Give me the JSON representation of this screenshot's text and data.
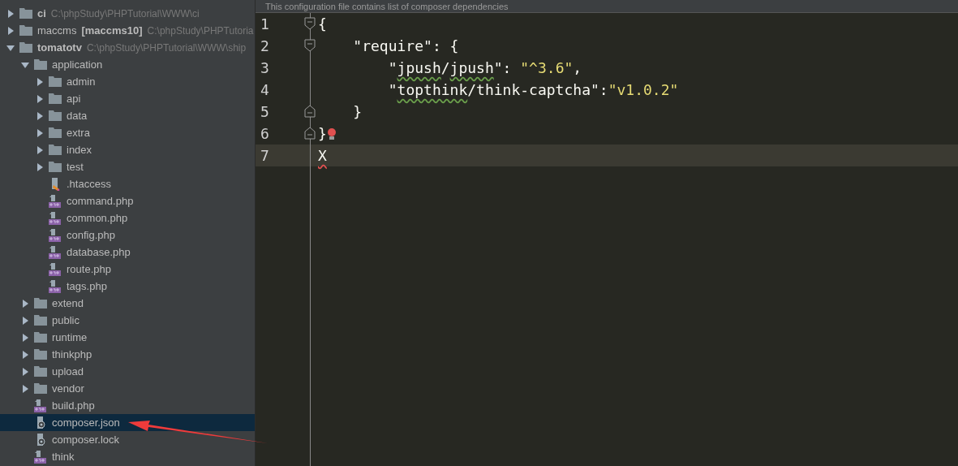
{
  "editor_banner": "This configuration file contains list of composer dependencies",
  "project_tree": [
    {
      "name": "ci",
      "bold": true,
      "path": "C:\\phpStudy\\PHPTutorial\\WWW\\ci",
      "kind": "folder",
      "expanded": false,
      "selected": false
    },
    {
      "name": "maccms",
      "bold": false,
      "module": "[maccms10]",
      "path": "C:\\phpStudy\\PHPTutoria",
      "kind": "folder",
      "expanded": false,
      "selected": false
    },
    {
      "name": "tomatotv",
      "bold": true,
      "path": "C:\\phpStudy\\PHPTutorial\\WWW\\ship",
      "kind": "folder",
      "expanded": true,
      "selected": false,
      "children": [
        {
          "name": "application",
          "kind": "folder",
          "expanded": true,
          "selected": false,
          "children": [
            {
              "name": "admin",
              "kind": "folder",
              "expanded": false,
              "selected": false
            },
            {
              "name": "api",
              "kind": "folder",
              "expanded": false,
              "selected": false
            },
            {
              "name": "data",
              "kind": "folder",
              "expanded": false,
              "selected": false
            },
            {
              "name": "extra",
              "kind": "folder",
              "expanded": false,
              "selected": false
            },
            {
              "name": "index",
              "kind": "folder",
              "expanded": false,
              "selected": false
            },
            {
              "name": "test",
              "kind": "folder",
              "expanded": false,
              "selected": false
            },
            {
              "name": ".htaccess",
              "kind": "htaccess",
              "selected": false
            },
            {
              "name": "command.php",
              "kind": "php",
              "selected": false
            },
            {
              "name": "common.php",
              "kind": "php",
              "selected": false
            },
            {
              "name": "config.php",
              "kind": "php",
              "selected": false
            },
            {
              "name": "database.php",
              "kind": "php",
              "selected": false
            },
            {
              "name": "route.php",
              "kind": "php",
              "selected": false
            },
            {
              "name": "tags.php",
              "kind": "php",
              "selected": false
            }
          ]
        },
        {
          "name": "extend",
          "kind": "folder",
          "expanded": false,
          "selected": false
        },
        {
          "name": "public",
          "kind": "folder",
          "expanded": false,
          "selected": false
        },
        {
          "name": "runtime",
          "kind": "folder",
          "expanded": false,
          "selected": false
        },
        {
          "name": "thinkphp",
          "kind": "folder",
          "expanded": false,
          "selected": false
        },
        {
          "name": "upload",
          "kind": "folder",
          "expanded": false,
          "selected": false
        },
        {
          "name": "vendor",
          "kind": "folder",
          "expanded": false,
          "selected": false
        },
        {
          "name": "build.php",
          "kind": "php",
          "selected": false
        },
        {
          "name": "composer.json",
          "kind": "composer",
          "selected": true
        },
        {
          "name": "composer.lock",
          "kind": "composer",
          "selected": false
        },
        {
          "name": "think",
          "kind": "php",
          "selected": false
        }
      ]
    }
  ],
  "code_lines": [
    {
      "number": "1",
      "kind": "fold-start",
      "current": false,
      "tokens": [
        {
          "text": "{",
          "kind": "punct"
        }
      ]
    },
    {
      "number": "2",
      "kind": "fold-start",
      "current": false,
      "tokens": [
        {
          "text": "    \"require\": {",
          "kind": "punct"
        }
      ]
    },
    {
      "number": "3",
      "kind": "plain",
      "current": false,
      "tokens": [
        {
          "text": "        \"",
          "kind": "punct"
        },
        {
          "text": "jpush",
          "kind": "typo"
        },
        {
          "text": "/",
          "kind": "punct"
        },
        {
          "text": "jpush",
          "kind": "typo"
        },
        {
          "text": "\": ",
          "kind": "punct"
        },
        {
          "text": "\"^3.6\"",
          "kind": "string"
        },
        {
          "text": ",",
          "kind": "punct"
        }
      ]
    },
    {
      "number": "4",
      "kind": "plain",
      "current": false,
      "tokens": [
        {
          "text": "        \"",
          "kind": "punct"
        },
        {
          "text": "topthink",
          "kind": "typo"
        },
        {
          "text": "/think-captcha\":",
          "kind": "punct"
        },
        {
          "text": "\"v1.0.2\"",
          "kind": "string"
        }
      ]
    },
    {
      "number": "5",
      "kind": "fold-end",
      "current": false,
      "tokens": [
        {
          "text": "    }",
          "kind": "punct"
        }
      ]
    },
    {
      "number": "6",
      "kind": "fold-end",
      "current": false,
      "bulb": true,
      "tokens": [
        {
          "text": "}",
          "kind": "punct"
        }
      ]
    },
    {
      "number": "7",
      "kind": "plain",
      "current": true,
      "tokens": [
        {
          "text": "X",
          "kind": "error"
        }
      ]
    }
  ]
}
